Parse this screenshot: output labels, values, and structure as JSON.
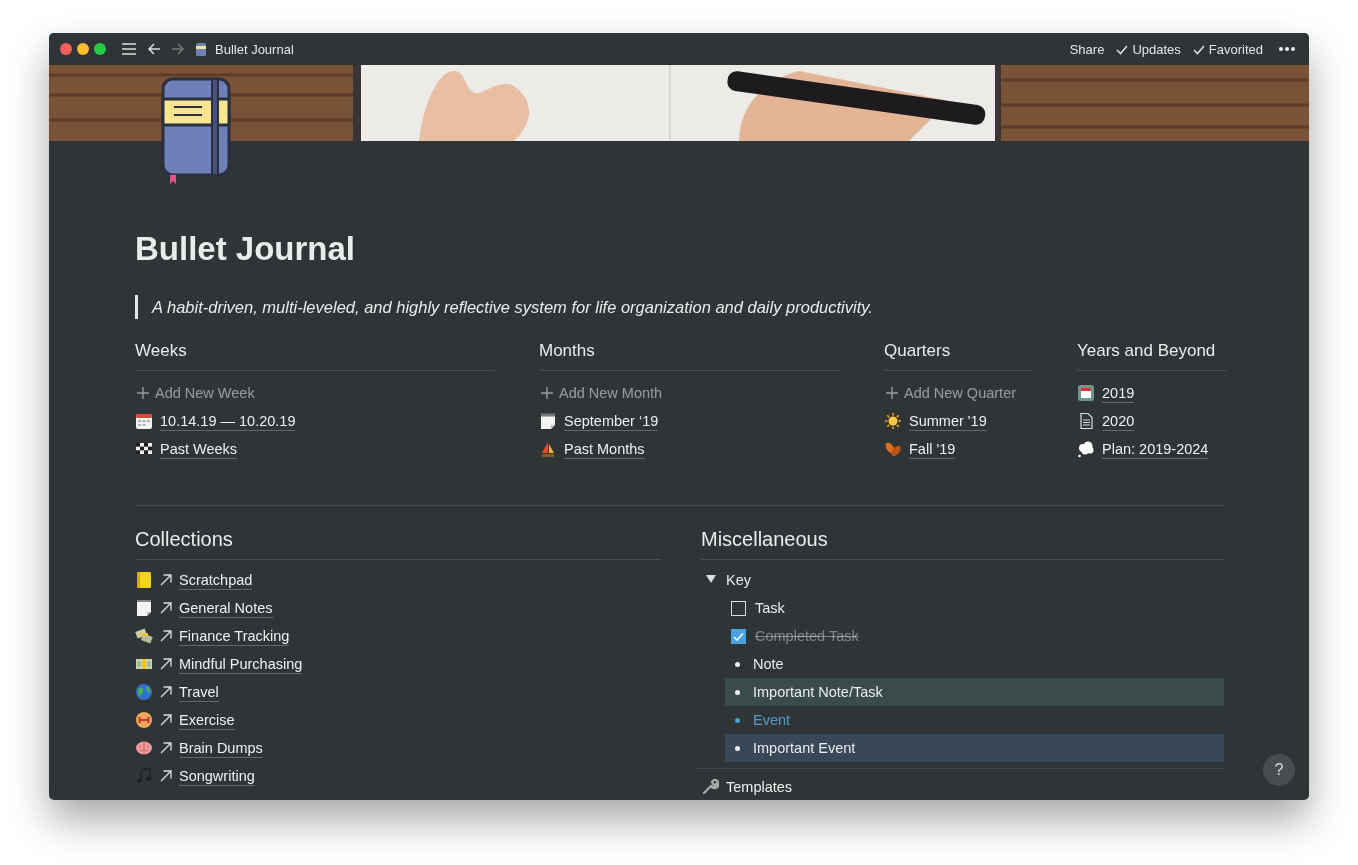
{
  "window": {
    "title": "Bullet Journal",
    "actions": [
      {
        "label": "Share",
        "checked": false
      },
      {
        "label": "Updates",
        "checked": true
      },
      {
        "label": "Favorited",
        "checked": true
      }
    ]
  },
  "page": {
    "title": "Bullet Journal",
    "quote": "A habit-driven, multi-leveled, and highly reflective system for life organization and daily productivity."
  },
  "columns": [
    {
      "heading": "Weeks",
      "add_label": "Add New Week",
      "links": [
        "10.14.19 — 10.20.19",
        "Past Weeks"
      ]
    },
    {
      "heading": "Months",
      "add_label": "Add New Month",
      "links": [
        "September ‘19",
        "Past Months"
      ]
    },
    {
      "heading": "Quarters",
      "add_label": "Add New Quarter",
      "links": [
        "Summer '19",
        "Fall '19"
      ]
    },
    {
      "heading": "Years and Beyond",
      "links": [
        "2019",
        "2020",
        "Plan: 2019-2024"
      ]
    }
  ],
  "collections": {
    "heading": "Collections",
    "links": [
      "Scratchpad",
      "General Notes",
      "Finance Tracking",
      "Mindful Purchasing",
      "Travel",
      "Exercise",
      "Brain Dumps",
      "Songwriting"
    ]
  },
  "miscellaneous": {
    "heading": "Miscellaneous",
    "toggle": {
      "label": "Key",
      "expanded": true,
      "items": [
        {
          "kind": "checkbox",
          "label": "Task",
          "checked": false
        },
        {
          "kind": "checkbox",
          "label": "Completed Task",
          "checked": true
        },
        {
          "kind": "note",
          "label": "Note"
        },
        {
          "kind": "important_note",
          "label": "Important Note/Task"
        },
        {
          "kind": "event",
          "label": "Event"
        },
        {
          "kind": "important_event",
          "label": "Important Event"
        }
      ]
    },
    "links": [
      "Templates"
    ]
  },
  "help_button": "?"
}
